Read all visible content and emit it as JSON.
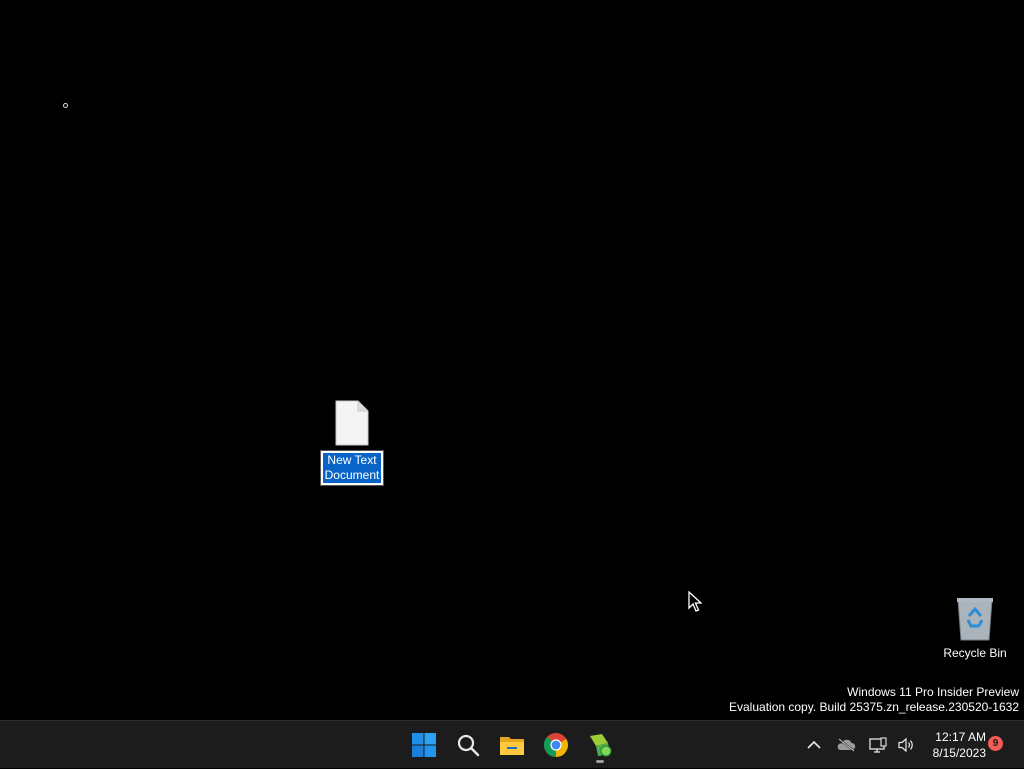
{
  "desktop": {
    "icons": [
      {
        "label_line1": "New Text",
        "label_line2": "Document",
        "icon": "text-document-icon",
        "state": "renaming"
      },
      {
        "label": "Recycle Bin",
        "icon": "recycle-bin-icon"
      }
    ],
    "watermark": {
      "line1": "Windows 11 Pro Insider Preview",
      "line2": "Evaluation copy. Build 25375.zn_release.230520-1632"
    }
  },
  "taskbar": {
    "apps": [
      {
        "name": "start-button",
        "icon": "windows-logo-icon"
      },
      {
        "name": "search-button",
        "icon": "search-icon"
      },
      {
        "name": "file-explorer-button",
        "icon": "folder-icon"
      },
      {
        "name": "chrome-button",
        "icon": "chrome-icon"
      },
      {
        "name": "app-button",
        "icon": "green-app-icon",
        "running": true
      }
    ],
    "tray": {
      "icons": [
        "chevron-up-icon",
        "onedrive-offline-icon",
        "network-icon",
        "volume-icon"
      ],
      "time": "12:17 AM",
      "date": "8/15/2023",
      "notifications": "9"
    }
  },
  "colors": {
    "desktop_bg": "#000000",
    "taskbar_bg": "#1c1c1c",
    "selection": "#0a64c8",
    "badge": "#f25c54"
  }
}
